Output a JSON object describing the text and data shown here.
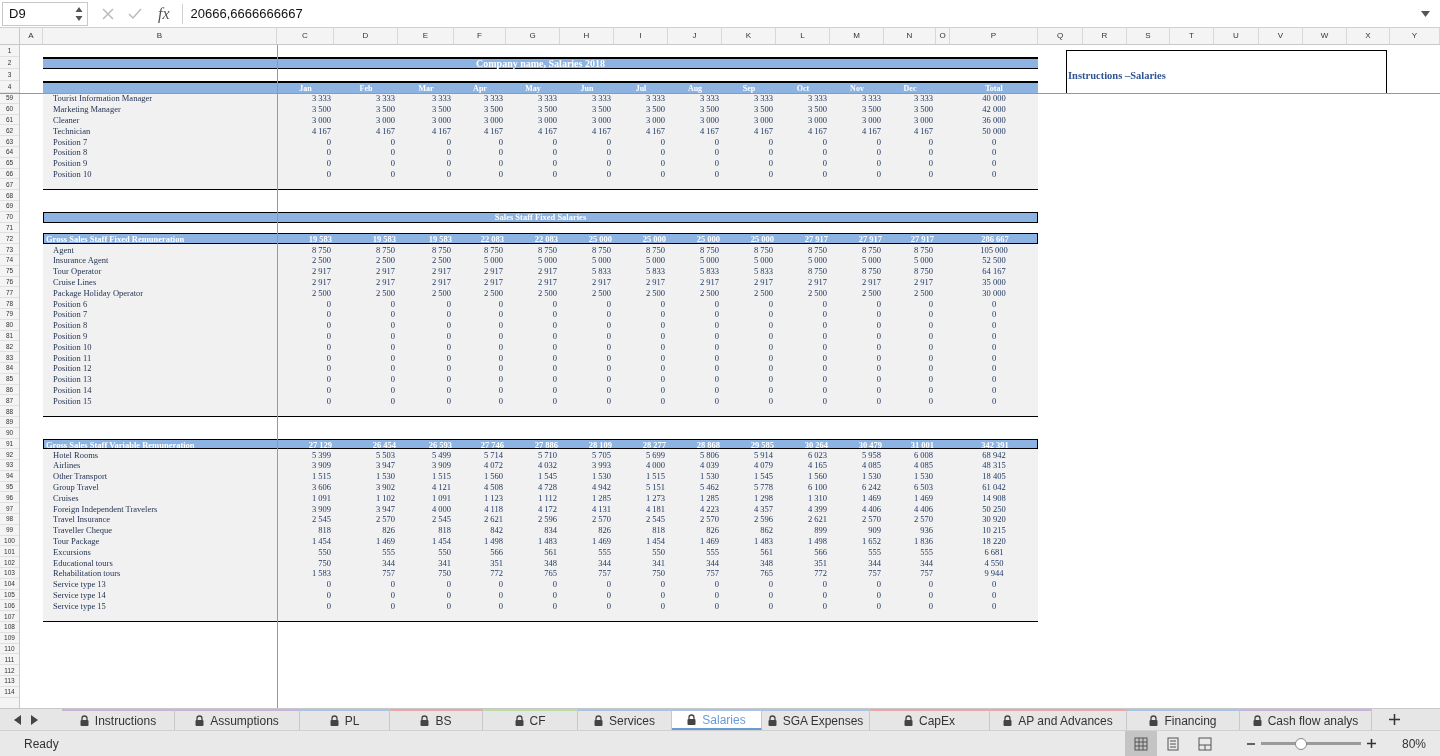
{
  "formula_bar": {
    "cell_ref": "D9",
    "function_label": "fx",
    "formula": "20666,6666666667"
  },
  "columns": [
    "A",
    "B",
    "C",
    "D",
    "E",
    "F",
    "G",
    "H",
    "I",
    "J",
    "K",
    "L",
    "M",
    "N",
    "O",
    "P",
    "Q",
    "R",
    "S",
    "T",
    "U",
    "V",
    "W",
    "X",
    "Y"
  ],
  "instructions_box": {
    "title": "Instructions –Salaries"
  },
  "rows": [
    {
      "num": "1",
      "kind": "blank"
    },
    {
      "num": "2",
      "kind": "title",
      "text": "Company name, Salaries 2018"
    },
    {
      "num": "3",
      "kind": "blank"
    },
    {
      "num": "4",
      "kind": "header",
      "cells": [
        "Jan",
        "Feb",
        "Mar",
        "Apr",
        "May",
        "Jun",
        "Jul",
        "Aug",
        "Sep",
        "Oct",
        "Nov",
        "Dec"
      ],
      "total": "Total"
    },
    {
      "num": "59",
      "kind": "data",
      "label": "Tourist Information Manager",
      "cells": [
        "3 333",
        "3 333",
        "3 333",
        "3 333",
        "3 333",
        "3 333",
        "3 333",
        "3 333",
        "3 333",
        "3 333",
        "3 333",
        "3 333"
      ],
      "total": "40 000"
    },
    {
      "num": "60",
      "kind": "data",
      "label": "Marketing Manager",
      "cells": [
        "3 500",
        "3 500",
        "3 500",
        "3 500",
        "3 500",
        "3 500",
        "3 500",
        "3 500",
        "3 500",
        "3 500",
        "3 500",
        "3 500"
      ],
      "total": "42 000"
    },
    {
      "num": "61",
      "kind": "data",
      "label": "Cleaner",
      "cells": [
        "3 000",
        "3 000",
        "3 000",
        "3 000",
        "3 000",
        "3 000",
        "3 000",
        "3 000",
        "3 000",
        "3 000",
        "3 000",
        "3 000"
      ],
      "total": "36 000"
    },
    {
      "num": "62",
      "kind": "data",
      "label": "Technician",
      "cells": [
        "4 167",
        "4 167",
        "4 167",
        "4 167",
        "4 167",
        "4 167",
        "4 167",
        "4 167",
        "4 167",
        "4 167",
        "4 167",
        "4 167"
      ],
      "total": "50 000"
    },
    {
      "num": "63",
      "kind": "data",
      "label": "Position 7",
      "cells": [
        "0",
        "0",
        "0",
        "0",
        "0",
        "0",
        "0",
        "0",
        "0",
        "0",
        "0",
        "0"
      ],
      "total": "0"
    },
    {
      "num": "64",
      "kind": "data",
      "label": "Position 8",
      "cells": [
        "0",
        "0",
        "0",
        "0",
        "0",
        "0",
        "0",
        "0",
        "0",
        "0",
        "0",
        "0"
      ],
      "total": "0"
    },
    {
      "num": "65",
      "kind": "data",
      "label": "Position 9",
      "cells": [
        "0",
        "0",
        "0",
        "0",
        "0",
        "0",
        "0",
        "0",
        "0",
        "0",
        "0",
        "0"
      ],
      "total": "0"
    },
    {
      "num": "66",
      "kind": "data",
      "label": "Position 10",
      "cells": [
        "0",
        "0",
        "0",
        "0",
        "0",
        "0",
        "0",
        "0",
        "0",
        "0",
        "0",
        "0"
      ],
      "total": "0"
    },
    {
      "num": "67",
      "kind": "end"
    },
    {
      "num": "68",
      "kind": "blank"
    },
    {
      "num": "69",
      "kind": "blank"
    },
    {
      "num": "70",
      "kind": "section",
      "text": "Sales Staff Fixed Salaries"
    },
    {
      "num": "71",
      "kind": "blank"
    },
    {
      "num": "72",
      "kind": "total",
      "label": "Gross Sales Staff Fixed Remuneration",
      "cells": [
        "19 583",
        "19 583",
        "19 583",
        "22 083",
        "22 083",
        "25 000",
        "25 000",
        "25 000",
        "25 000",
        "27 917",
        "27 917",
        "27 917"
      ],
      "total": "286 667"
    },
    {
      "num": "73",
      "kind": "data",
      "label": "Agent",
      "cells": [
        "8 750",
        "8 750",
        "8 750",
        "8 750",
        "8 750",
        "8 750",
        "8 750",
        "8 750",
        "8 750",
        "8 750",
        "8 750",
        "8 750"
      ],
      "total": "105 000"
    },
    {
      "num": "74",
      "kind": "data",
      "label": "Insurance Agent",
      "cells": [
        "2 500",
        "2 500",
        "2 500",
        "5 000",
        "5 000",
        "5 000",
        "5 000",
        "5 000",
        "5 000",
        "5 000",
        "5 000",
        "5 000"
      ],
      "total": "52 500"
    },
    {
      "num": "75",
      "kind": "data",
      "label": "Tour Operator",
      "cells": [
        "2 917",
        "2 917",
        "2 917",
        "2 917",
        "2 917",
        "5 833",
        "5 833",
        "5 833",
        "5 833",
        "8 750",
        "8 750",
        "8 750"
      ],
      "total": "64 167"
    },
    {
      "num": "76",
      "kind": "data",
      "label": "Cruise Lines",
      "cells": [
        "2 917",
        "2 917",
        "2 917",
        "2 917",
        "2 917",
        "2 917",
        "2 917",
        "2 917",
        "2 917",
        "2 917",
        "2 917",
        "2 917"
      ],
      "total": "35 000"
    },
    {
      "num": "77",
      "kind": "data",
      "label": "Package Holiday Operator",
      "cells": [
        "2 500",
        "2 500",
        "2 500",
        "2 500",
        "2 500",
        "2 500",
        "2 500",
        "2 500",
        "2 500",
        "2 500",
        "2 500",
        "2 500"
      ],
      "total": "30 000"
    },
    {
      "num": "78",
      "kind": "data",
      "label": "Position 6",
      "cells": [
        "0",
        "0",
        "0",
        "0",
        "0",
        "0",
        "0",
        "0",
        "0",
        "0",
        "0",
        "0"
      ],
      "total": "0"
    },
    {
      "num": "79",
      "kind": "data",
      "label": "Position 7",
      "cells": [
        "0",
        "0",
        "0",
        "0",
        "0",
        "0",
        "0",
        "0",
        "0",
        "0",
        "0",
        "0"
      ],
      "total": "0"
    },
    {
      "num": "80",
      "kind": "data",
      "label": "Position 8",
      "cells": [
        "0",
        "0",
        "0",
        "0",
        "0",
        "0",
        "0",
        "0",
        "0",
        "0",
        "0",
        "0"
      ],
      "total": "0"
    },
    {
      "num": "81",
      "kind": "data",
      "label": "Position 9",
      "cells": [
        "0",
        "0",
        "0",
        "0",
        "0",
        "0",
        "0",
        "0",
        "0",
        "0",
        "0",
        "0"
      ],
      "total": "0"
    },
    {
      "num": "82",
      "kind": "data",
      "label": "Position 10",
      "cells": [
        "0",
        "0",
        "0",
        "0",
        "0",
        "0",
        "0",
        "0",
        "0",
        "0",
        "0",
        "0"
      ],
      "total": "0"
    },
    {
      "num": "83",
      "kind": "data",
      "label": "Position 11",
      "cells": [
        "0",
        "0",
        "0",
        "0",
        "0",
        "0",
        "0",
        "0",
        "0",
        "0",
        "0",
        "0"
      ],
      "total": "0"
    },
    {
      "num": "84",
      "kind": "data",
      "label": "Position 12",
      "cells": [
        "0",
        "0",
        "0",
        "0",
        "0",
        "0",
        "0",
        "0",
        "0",
        "0",
        "0",
        "0"
      ],
      "total": "0"
    },
    {
      "num": "85",
      "kind": "data",
      "label": "Position 13",
      "cells": [
        "0",
        "0",
        "0",
        "0",
        "0",
        "0",
        "0",
        "0",
        "0",
        "0",
        "0",
        "0"
      ],
      "total": "0"
    },
    {
      "num": "86",
      "kind": "data",
      "label": "Position 14",
      "cells": [
        "0",
        "0",
        "0",
        "0",
        "0",
        "0",
        "0",
        "0",
        "0",
        "0",
        "0",
        "0"
      ],
      "total": "0"
    },
    {
      "num": "87",
      "kind": "data",
      "label": "Position 15",
      "cells": [
        "0",
        "0",
        "0",
        "0",
        "0",
        "0",
        "0",
        "0",
        "0",
        "0",
        "0",
        "0"
      ],
      "total": "0"
    },
    {
      "num": "88",
      "kind": "end"
    },
    {
      "num": "89",
      "kind": "blank"
    },
    {
      "num": "90",
      "kind": "blank"
    },
    {
      "num": "91",
      "kind": "total",
      "label": "Gross Sales Staff Variable Remuneration",
      "cells": [
        "27 129",
        "26 454",
        "26 593",
        "27 746",
        "27 886",
        "28 109",
        "28 277",
        "28 868",
        "29 585",
        "30 264",
        "30 479",
        "31 001"
      ],
      "total": "342 391"
    },
    {
      "num": "92",
      "kind": "data",
      "label": "Hotel Rooms",
      "cells": [
        "5 399",
        "5 503",
        "5 499",
        "5 714",
        "5 710",
        "5 705",
        "5 699",
        "5 806",
        "5 914",
        "6 023",
        "5 958",
        "6 008"
      ],
      "total": "68 942"
    },
    {
      "num": "93",
      "kind": "data",
      "label": "Airlines",
      "cells": [
        "3 909",
        "3 947",
        "3 909",
        "4 072",
        "4 032",
        "3 993",
        "4 000",
        "4 039",
        "4 079",
        "4 165",
        "4 085",
        "4 085"
      ],
      "total": "48 315"
    },
    {
      "num": "94",
      "kind": "data",
      "label": "Other Transport",
      "cells": [
        "1 515",
        "1 530",
        "1 515",
        "1 560",
        "1 545",
        "1 530",
        "1 515",
        "1 530",
        "1 545",
        "1 560",
        "1 530",
        "1 530"
      ],
      "total": "18 405"
    },
    {
      "num": "95",
      "kind": "data",
      "label": "Group Travel",
      "cells": [
        "3 606",
        "3 902",
        "4 121",
        "4 508",
        "4 728",
        "4 942",
        "5 151",
        "5 462",
        "5 778",
        "6 100",
        "6 242",
        "6 503"
      ],
      "total": "61 042"
    },
    {
      "num": "96",
      "kind": "data",
      "label": "Cruises",
      "cells": [
        "1 091",
        "1 102",
        "1 091",
        "1 123",
        "1 112",
        "1 285",
        "1 273",
        "1 285",
        "1 298",
        "1 310",
        "1 469",
        "1 469"
      ],
      "total": "14 908"
    },
    {
      "num": "97",
      "kind": "data",
      "label": "Foreign Independent Travelers",
      "cells": [
        "3 909",
        "3 947",
        "4 000",
        "4 118",
        "4 172",
        "4 131",
        "4 181",
        "4 223",
        "4 357",
        "4 399",
        "4 406",
        "4 406"
      ],
      "total": "50 250"
    },
    {
      "num": "98",
      "kind": "data",
      "label": "Travel Insurance",
      "cells": [
        "2 545",
        "2 570",
        "2 545",
        "2 621",
        "2 596",
        "2 570",
        "2 545",
        "2 570",
        "2 596",
        "2 621",
        "2 570",
        "2 570"
      ],
      "total": "30 920"
    },
    {
      "num": "99",
      "kind": "data",
      "label": "Traveller Cheque",
      "cells": [
        "818",
        "826",
        "818",
        "842",
        "834",
        "826",
        "818",
        "826",
        "862",
        "899",
        "909",
        "936"
      ],
      "total": "10 215"
    },
    {
      "num": "100",
      "kind": "data",
      "label": "Tour Package",
      "cells": [
        "1 454",
        "1 469",
        "1 454",
        "1 498",
        "1 483",
        "1 469",
        "1 454",
        "1 469",
        "1 483",
        "1 498",
        "1 652",
        "1 836"
      ],
      "total": "18 220"
    },
    {
      "num": "101",
      "kind": "data",
      "label": "Excursions",
      "cells": [
        "550",
        "555",
        "550",
        "566",
        "561",
        "555",
        "550",
        "555",
        "561",
        "566",
        "555",
        "555"
      ],
      "total": "6 681"
    },
    {
      "num": "102",
      "kind": "data",
      "label": "Educational tours",
      "cells": [
        "750",
        "344",
        "341",
        "351",
        "348",
        "344",
        "341",
        "344",
        "348",
        "351",
        "344",
        "344"
      ],
      "total": "4 550"
    },
    {
      "num": "103",
      "kind": "data",
      "label": "Rehabilitation tours",
      "cells": [
        "1 583",
        "757",
        "750",
        "772",
        "765",
        "757",
        "750",
        "757",
        "765",
        "772",
        "757",
        "757"
      ],
      "total": "9 944"
    },
    {
      "num": "104",
      "kind": "data",
      "label": "Service type 13",
      "cells": [
        "0",
        "0",
        "0",
        "0",
        "0",
        "0",
        "0",
        "0",
        "0",
        "0",
        "0",
        "0"
      ],
      "total": "0"
    },
    {
      "num": "105",
      "kind": "data",
      "label": "Service type 14",
      "cells": [
        "0",
        "0",
        "0",
        "0",
        "0",
        "0",
        "0",
        "0",
        "0",
        "0",
        "0",
        "0"
      ],
      "total": "0"
    },
    {
      "num": "106",
      "kind": "data",
      "label": "Service type 15",
      "cells": [
        "0",
        "0",
        "0",
        "0",
        "0",
        "0",
        "0",
        "0",
        "0",
        "0",
        "0",
        "0"
      ],
      "total": "0"
    },
    {
      "num": "107",
      "kind": "end"
    },
    {
      "num": "108",
      "kind": "blank"
    },
    {
      "num": "109",
      "kind": "blank"
    },
    {
      "num": "110",
      "kind": "blank"
    },
    {
      "num": "111",
      "kind": "blank"
    },
    {
      "num": "112",
      "kind": "blank"
    },
    {
      "num": "113",
      "kind": "blank"
    },
    {
      "num": "114",
      "kind": "blank"
    }
  ],
  "sheet_tabs": [
    {
      "label": "Instructions",
      "color": "#c9b3dd",
      "selected": false
    },
    {
      "label": "Assumptions",
      "color": "#c9b3dd",
      "selected": false
    },
    {
      "label": "PL",
      "color": "#a9c4e8",
      "selected": false
    },
    {
      "label": "BS",
      "color": "#eba7a7",
      "selected": false
    },
    {
      "label": "CF",
      "color": "#bcdca6",
      "selected": false
    },
    {
      "label": "Services",
      "color": "#a9c4e8",
      "selected": false
    },
    {
      "label": "Salaries",
      "color": "#a9c4e8",
      "selected": true
    },
    {
      "label": "SGA Expenses",
      "color": "#a9c4e8",
      "selected": false
    },
    {
      "label": "CapEx",
      "color": "#eba7a7",
      "selected": false
    },
    {
      "label": "AP and Advances",
      "color": "#eba7a7",
      "selected": false
    },
    {
      "label": "Financing",
      "color": "#a9c4e8",
      "selected": false
    },
    {
      "label": "Cash flow analys",
      "color": "#c9b3dd",
      "selected": false
    }
  ],
  "status_bar": {
    "status": "Ready",
    "views": [
      {
        "kind": "normal",
        "selected": true
      },
      {
        "kind": "page-layout",
        "selected": false
      },
      {
        "kind": "page-break",
        "selected": false
      }
    ],
    "zoom_slider": {
      "level": 0.4
    },
    "zoom": "80%"
  }
}
